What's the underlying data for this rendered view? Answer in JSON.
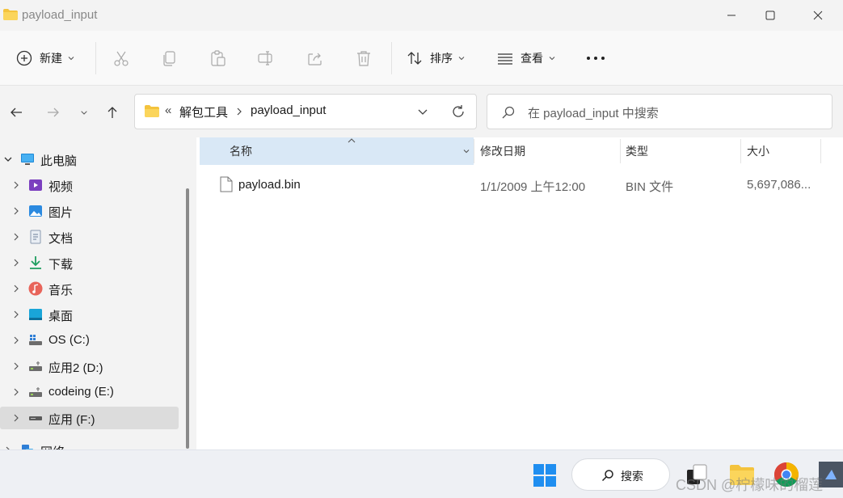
{
  "window": {
    "title": "payload_input",
    "controls": [
      "minimize-button",
      "maximize-button",
      "close-button"
    ]
  },
  "toolbar": {
    "new_label": "新建",
    "sort_label": "排序",
    "view_label": "查看",
    "more_label": "···",
    "icons": [
      "cut-icon",
      "copy-icon",
      "paste-icon",
      "rename-icon",
      "share-icon",
      "delete-icon"
    ]
  },
  "address": {
    "overflow": "«",
    "crumbs": [
      "解包工具",
      "payload_input"
    ]
  },
  "search": {
    "placeholder": "在 payload_input 中搜索"
  },
  "sidebar": {
    "items": [
      {
        "label": "此电脑",
        "icon": "computer-icon"
      },
      {
        "label": "视频",
        "icon": "video-icon"
      },
      {
        "label": "图片",
        "icon": "pictures-icon"
      },
      {
        "label": "文档",
        "icon": "documents-icon"
      },
      {
        "label": "下载",
        "icon": "download-icon"
      },
      {
        "label": "音乐",
        "icon": "music-icon"
      },
      {
        "label": "桌面",
        "icon": "desktop-icon"
      },
      {
        "label": "OS (C:)",
        "icon": "drive-c-icon"
      },
      {
        "label": "应用2 (D:)",
        "icon": "drive-icon"
      },
      {
        "label": "codeing (E:)",
        "icon": "drive-icon"
      },
      {
        "label": "应用 (F:)",
        "icon": "drive-icon"
      },
      {
        "label": "网络",
        "icon": "network-icon"
      }
    ]
  },
  "table": {
    "headers": [
      "名称",
      "修改日期",
      "类型",
      "大小"
    ],
    "rows": [
      {
        "name": "payload.bin",
        "modified": "1/1/2009 上午12:00",
        "type": "BIN 文件",
        "size": "5,697,086..."
      }
    ]
  },
  "taskbar": {
    "search_label": "搜索"
  },
  "watermark": "CSDN @柠檬味的榴莲",
  "colors": {
    "accent": "#0067c0",
    "selected_header": "#d9e8f6",
    "selected_nav": "#dcdcdc"
  }
}
